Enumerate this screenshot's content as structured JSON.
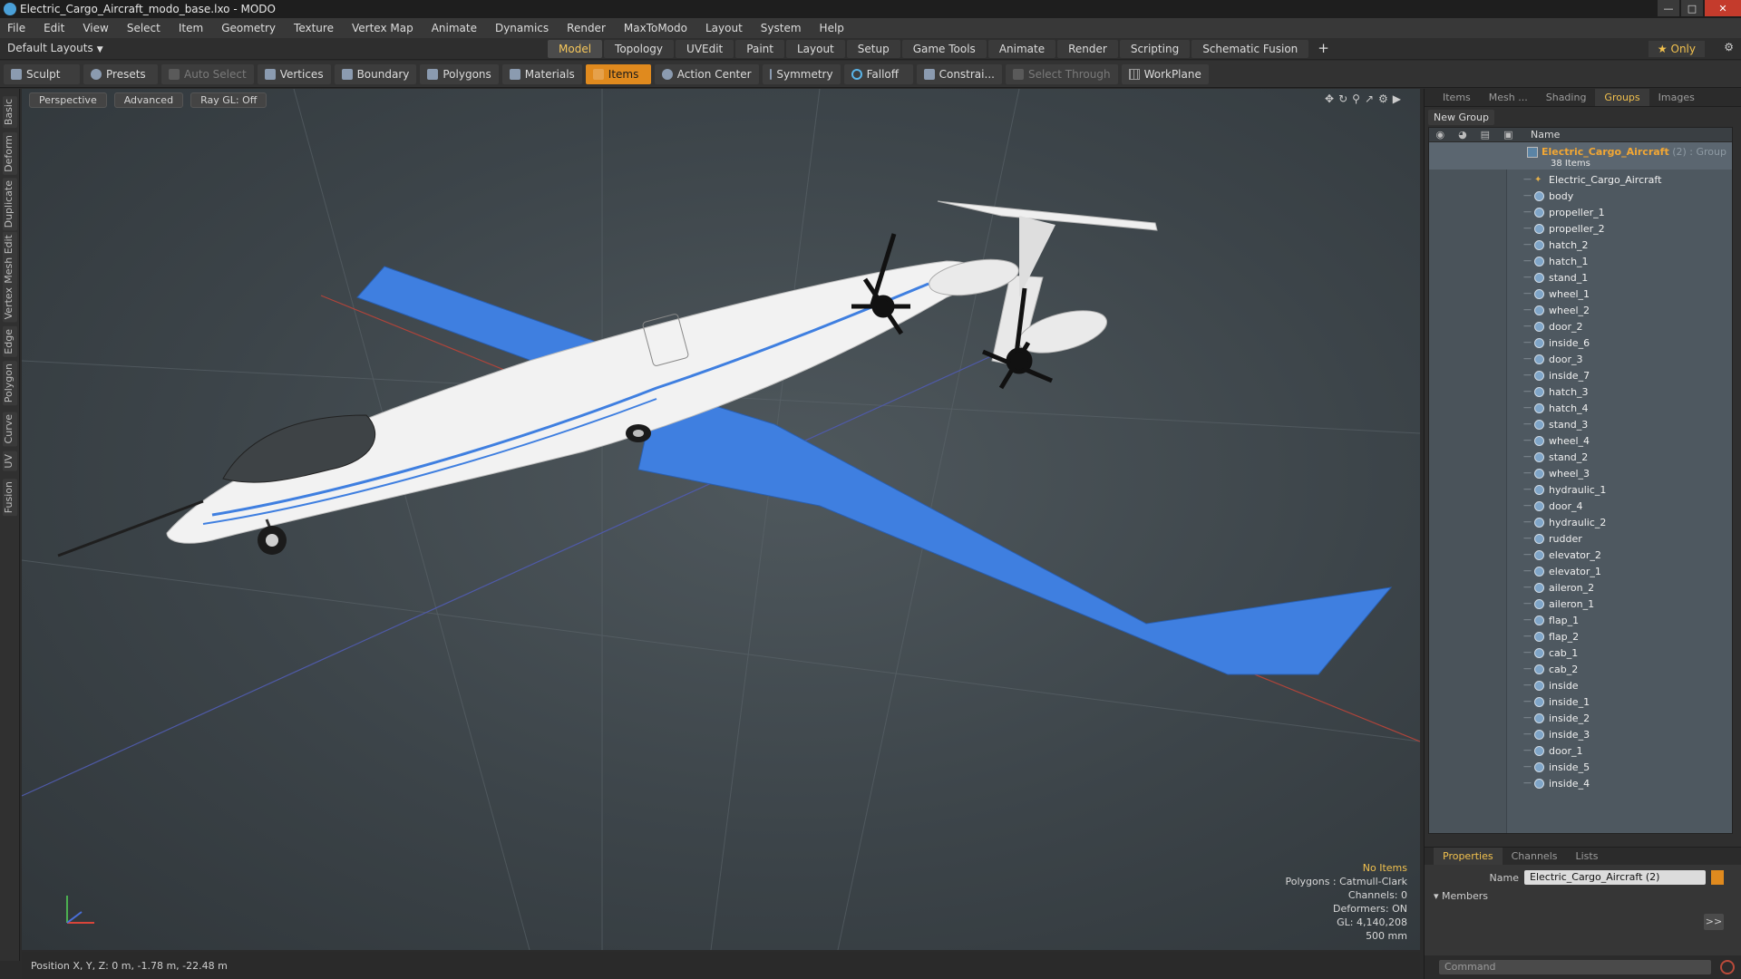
{
  "window": {
    "title": "Electric_Cargo_Aircraft_modo_base.lxo - MODO"
  },
  "menu": [
    "File",
    "Edit",
    "View",
    "Select",
    "Item",
    "Geometry",
    "Texture",
    "Vertex Map",
    "Animate",
    "Dynamics",
    "Render",
    "MaxToModo",
    "Layout",
    "System",
    "Help"
  ],
  "layouts": {
    "default_label": "Default Layouts",
    "tabs": [
      "Model",
      "Topology",
      "UVEdit",
      "Paint",
      "Layout",
      "Setup",
      "Game Tools",
      "Animate",
      "Render",
      "Scripting",
      "Schematic Fusion"
    ],
    "active_tab": "Model",
    "plus": "+",
    "only_label": "Only"
  },
  "toolbar": {
    "sculpt": "Sculpt",
    "presets": "Presets",
    "auto_select": "Auto Select",
    "vertices": "Vertices",
    "boundary": "Boundary",
    "polygons": "Polygons",
    "materials": "Materials",
    "items": "Items",
    "action_center": "Action Center",
    "symmetry": "Symmetry",
    "falloff": "Falloff",
    "constraints": "Constrai...",
    "select_through": "Select Through",
    "workplane": "WorkPlane"
  },
  "left_tabs": [
    "Basic",
    "Deform",
    "Duplicate",
    "Mesh Edit",
    "Vertex",
    "Edge",
    "Polygon",
    "Curve",
    "UV",
    "Fusion"
  ],
  "viewport": {
    "view": "Perspective",
    "shading": "Advanced",
    "raygl": "Ray GL: Off",
    "stats": {
      "no_items": "No Items",
      "polygons": "Polygons : Catmull-Clark",
      "channels": "Channels: 0",
      "deformers": "Deformers: ON",
      "gl": "GL: 4,140,208",
      "scale": "500 mm"
    }
  },
  "status": {
    "position": "Position X, Y, Z:  0 m, -1.78 m, -22.48 m"
  },
  "right_panel": {
    "tabs": [
      "Items",
      "Mesh ...",
      "Shading",
      "Groups",
      "Images"
    ],
    "active_tab": "Groups",
    "new_group": "New Group",
    "column_name": "Name",
    "group": {
      "name": "Electric_Cargo_Aircraft",
      "extra": " (2) : Group",
      "count": "38 Items"
    },
    "items": [
      "Electric_Cargo_Aircraft",
      "body",
      "propeller_1",
      "propeller_2",
      "hatch_2",
      "hatch_1",
      "stand_1",
      "wheel_1",
      "wheel_2",
      "door_2",
      "inside_6",
      "door_3",
      "inside_7",
      "hatch_3",
      "hatch_4",
      "stand_3",
      "wheel_4",
      "stand_2",
      "wheel_3",
      "hydraulic_1",
      "door_4",
      "hydraulic_2",
      "rudder",
      "elevator_2",
      "elevator_1",
      "aileron_2",
      "aileron_1",
      "flap_1",
      "flap_2",
      "cab_1",
      "cab_2",
      "inside",
      "inside_1",
      "inside_2",
      "inside_3",
      "door_1",
      "inside_5",
      "inside_4"
    ],
    "props_tabs": [
      "Properties",
      "Channels",
      "Lists"
    ],
    "name_label": "Name",
    "name_value": "Electric_Cargo_Aircraft (2)",
    "members_label": "Members",
    "arrow_btn": ">>",
    "command_placeholder": "Command"
  },
  "colors": {
    "accent": "#f2c14e",
    "active_tool": "#e08a1e",
    "wing": "#3f7fe0",
    "fuselage": "#f2f2f2"
  }
}
